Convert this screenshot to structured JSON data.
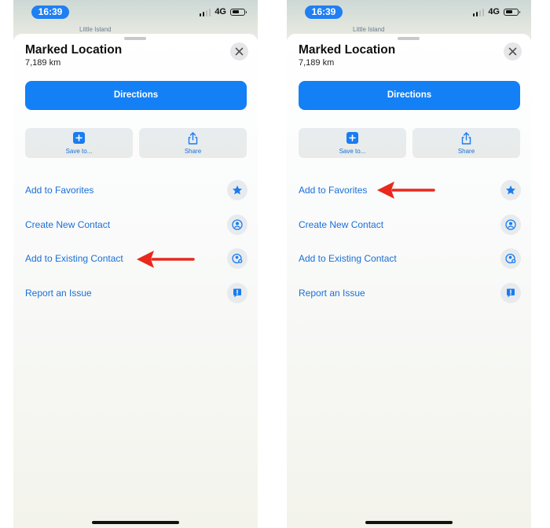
{
  "screens": [
    {
      "status_time": "16:39",
      "network": "4G",
      "map_label": "Little Island",
      "title": "Marked Location",
      "distance": "7,189 km",
      "directions_label": "Directions",
      "save_label": "Save to...",
      "share_label": "Share",
      "actions": [
        "Add to Favorites",
        "Create New Contact",
        "Add to Existing Contact",
        "Report an Issue"
      ],
      "highlighted_action": "Add to Existing Contact"
    },
    {
      "status_time": "16:39",
      "network": "4G",
      "map_label": "Little Island",
      "title": "Marked Location",
      "distance": "7,189 km",
      "directions_label": "Directions",
      "save_label": "Save to...",
      "share_label": "Share",
      "actions": [
        "Add to Favorites",
        "Create New Contact",
        "Add to Existing Contact",
        "Report an Issue"
      ],
      "highlighted_action": "Add to Favorites"
    }
  ],
  "icons": [
    "close-icon",
    "plus-icon",
    "share-icon",
    "star-icon",
    "person-circle-icon",
    "person-add-icon",
    "report-bubble-icon",
    "red-arrow-icon"
  ],
  "colors": {
    "accent": "#1380f6",
    "link": "#1a6fd8",
    "arrow": "#e8291c"
  }
}
